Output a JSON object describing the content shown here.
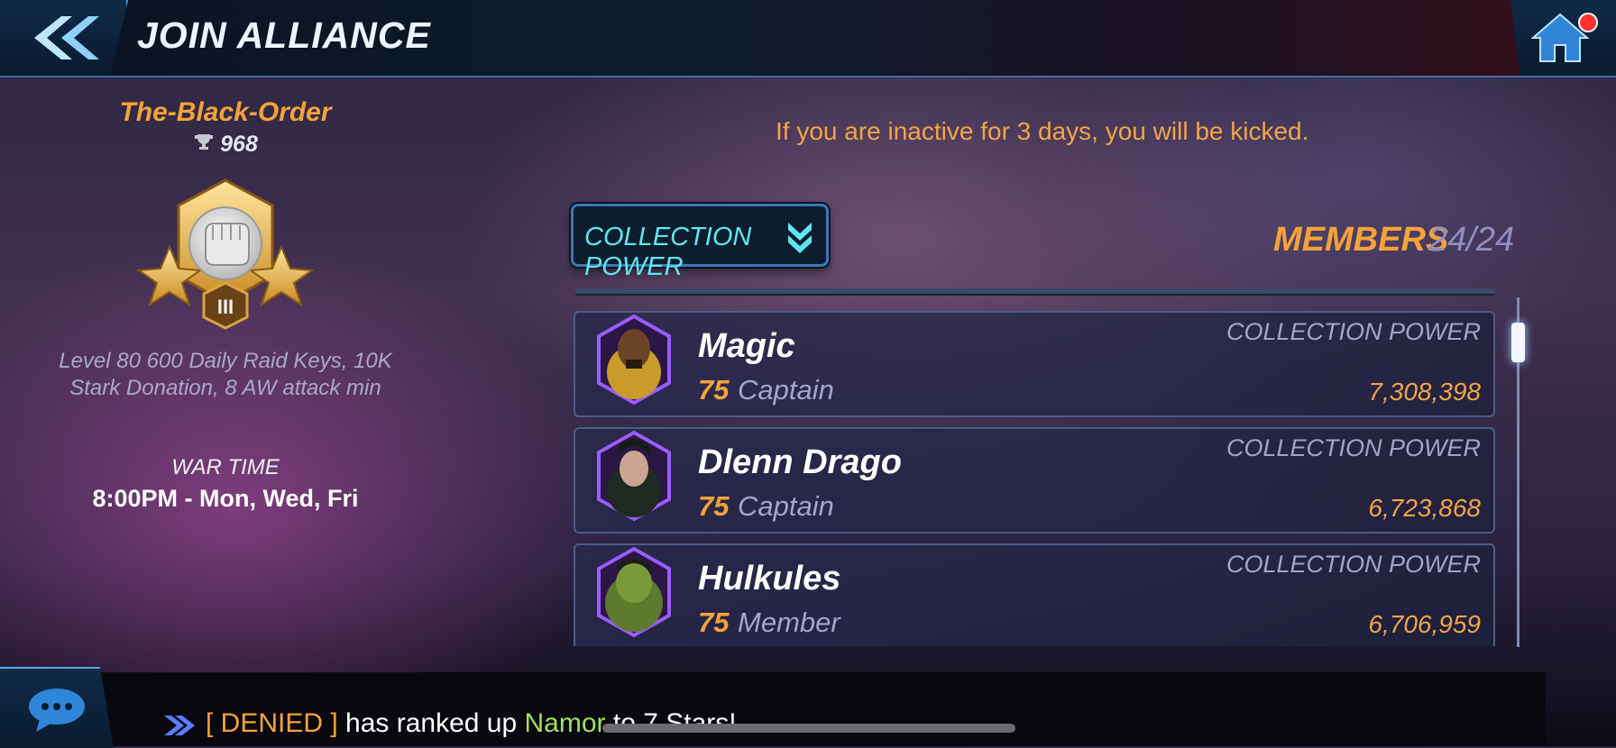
{
  "header": {
    "title": "JOIN ALLIANCE",
    "back_icon": "double-chevron-left-icon",
    "home_icon": "home-icon"
  },
  "alliance": {
    "name": "The-Black-Order",
    "trophies": "968",
    "emblem_tier": "III",
    "description_line1": "Level 80 600 Daily Raid Keys, 10K",
    "description_line2": "Stark Donation, 8 AW attack min",
    "war_time_label": "WAR TIME",
    "war_time_value": "8:00PM - Mon, Wed, Fri"
  },
  "notice": "If you are inactive for 3 days, you will be kicked.",
  "sort": {
    "label": "COLLECTION POWER"
  },
  "members": {
    "label": "MEMBERS",
    "count": "24/24",
    "rows": [
      {
        "name": "Magic",
        "level": "75",
        "role": "Captain",
        "cp_label": "COLLECTION POWER",
        "cp_value": "7,308,398"
      },
      {
        "name": "Dlenn Drago",
        "level": "75",
        "role": "Captain",
        "cp_label": "COLLECTION POWER",
        "cp_value": "6,723,868"
      },
      {
        "name": "Hulkules",
        "level": "75",
        "role": "Member",
        "cp_label": "COLLECTION POWER",
        "cp_value": "6,706,959"
      }
    ]
  },
  "chat": {
    "icon": "chat-bubble-icon",
    "ticker_tag": "[ DENIED ]",
    "ticker_text": " has ranked up ",
    "ticker_hero": "Namor",
    "ticker_suffix": " to 7 Stars!"
  },
  "colors": {
    "accent_orange": "#f5a23a",
    "accent_cyan": "#5fe6f4",
    "frame_blue": "#3a78b5"
  }
}
